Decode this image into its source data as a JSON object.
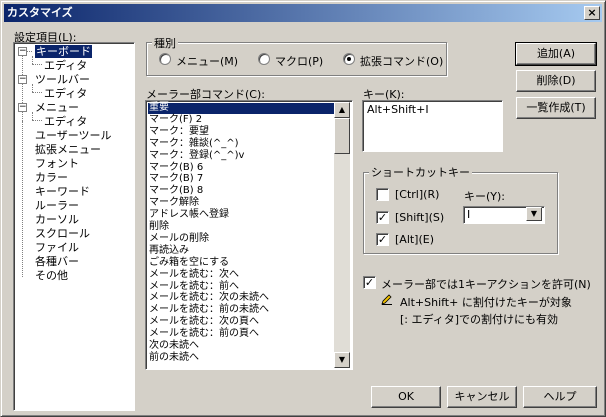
{
  "window": {
    "title": "カスタマイズ",
    "close_glyph": "×"
  },
  "tree": {
    "label": "設定項目(L):",
    "items": [
      {
        "label": "キーボード"
      },
      {
        "label": "エディタ"
      },
      {
        "label": "ツールバー"
      },
      {
        "label": "エディタ"
      },
      {
        "label": "メニュー"
      },
      {
        "label": "エディタ"
      },
      {
        "label": "ユーザーツール"
      },
      {
        "label": "拡張メニュー"
      },
      {
        "label": "フォント"
      },
      {
        "label": "カラー"
      },
      {
        "label": "キーワード"
      },
      {
        "label": "ルーラー"
      },
      {
        "label": "カーソル"
      },
      {
        "label": "スクロール"
      },
      {
        "label": "ファイル"
      },
      {
        "label": "各種バー"
      },
      {
        "label": "その他"
      }
    ]
  },
  "kind": {
    "title": "種別",
    "options": [
      "メニュー(M)",
      "マクロ(P)",
      "拡張コマンド(O)"
    ],
    "selected": 2
  },
  "commands": {
    "label": "メーラー部コマンド(C):",
    "items": [
      "重要",
      "マーク(F) 2",
      "マーク：要望",
      "マーク：雑談(^_^)",
      "マーク：登録(^_^)v",
      "マーク(B) 6",
      "マーク(B) 7",
      "マーク(B) 8",
      "マーク解除",
      "アドレス帳へ登録",
      "削除",
      "メールの削除",
      "再読込み",
      "ごみ箱を空にする",
      "メールを読む：次へ",
      "メールを読む：前へ",
      "メールを読む：次の未読へ",
      "メールを読む：前の未読へ",
      "メールを読む：次の頁へ",
      "メールを読む：前の頁へ",
      "次の未読へ",
      "前の未読へ"
    ]
  },
  "key_box": {
    "label": "キー(K):",
    "value": "Alt+Shift+I"
  },
  "shortcut": {
    "title": "ショートカットキー",
    "ctrl_label": "[Ctrl](R)",
    "shift_label": "[Shift](S)",
    "alt_label": "[Alt](E)",
    "ctrl": false,
    "shift": true,
    "alt": true,
    "key_label": "キー(Y):",
    "key_value": "I"
  },
  "allow_one_key": {
    "label": "メーラー部では1キーアクションを許可(N)",
    "checked": true
  },
  "notes": {
    "line1": "Alt+Shift+ に割付けたキーが対象",
    "line2": "[: エディタ]での割付けにも有効"
  },
  "buttons": {
    "add": "追加(A)",
    "delete": "削除(D)",
    "list": "一覧作成(T)",
    "ok": "OK",
    "cancel": "キャンセル",
    "help": "ヘルプ"
  },
  "glyphs": {
    "check": "✓",
    "minus": "−",
    "up": "▲",
    "down": "▼"
  }
}
